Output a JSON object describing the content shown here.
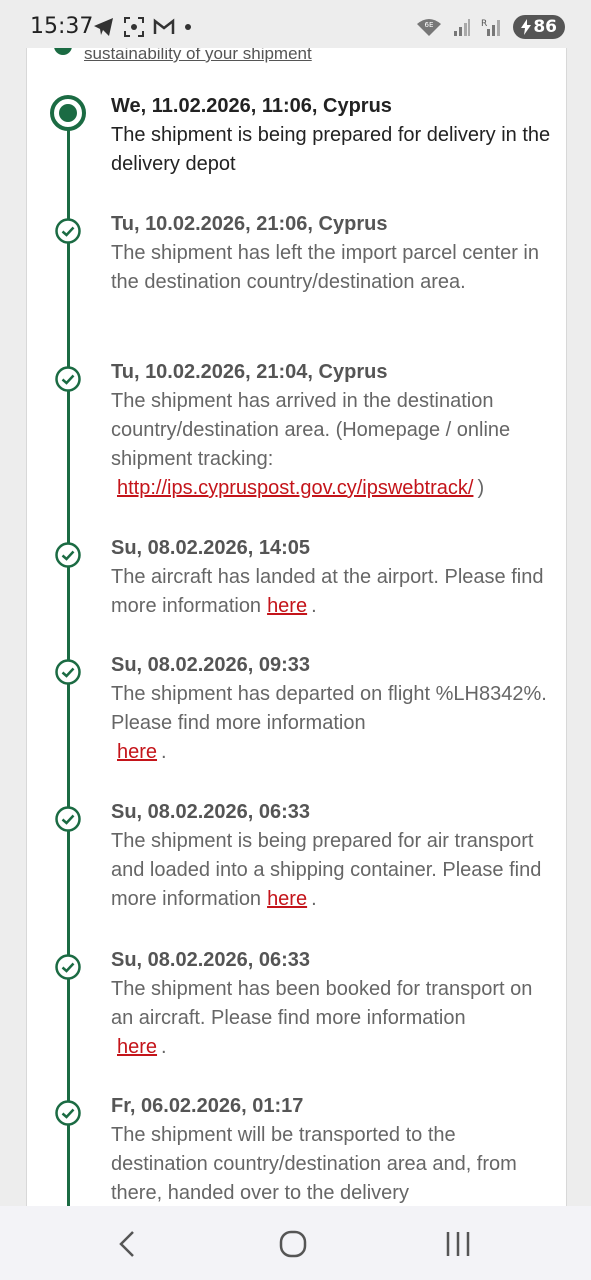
{
  "status_bar": {
    "time": "15:37",
    "battery": "86",
    "left_icons": [
      "telegram-icon",
      "screenshot-icon",
      "gmail-icon",
      "dot-icon"
    ],
    "right_icons": [
      "wifi-6e-icon",
      "signal-icon",
      "signal-r-icon",
      "battery-charging-icon"
    ]
  },
  "header": {
    "link_text": "sustainability of your shipment"
  },
  "events": [
    {
      "date": "We, 11.02.2026, 11:06, Cyprus",
      "desc": "The shipment is being prepared for delivery in the delivery depot",
      "link": "",
      "suffix": "",
      "current": true
    },
    {
      "date": "Tu, 10.02.2026, 21:06, Cyprus",
      "desc": "The shipment has left the import parcel center in the destination country/destination area.",
      "link": "",
      "suffix": ""
    },
    {
      "date": "Tu, 10.02.2026, 21:04, Cyprus",
      "desc": "The shipment has arrived in the destination country/destination area. (Homepage / online shipment tracking:",
      "link": "http://ips.cypruspost.gov.cy/ipswebtrack/",
      "suffix": ")"
    },
    {
      "date": "Su, 08.02.2026, 14:05",
      "desc": "The aircraft has landed at the airport. Please find more information",
      "link": "here",
      "suffix": "."
    },
    {
      "date": "Su, 08.02.2026, 09:33",
      "desc": "The shipment has departed on flight %LH8342%. Please find more information",
      "link": "here",
      "suffix": "."
    },
    {
      "date": "Su, 08.02.2026, 06:33",
      "desc": "The shipment is being prepared for air transport and loaded into a shipping container. Please find more information",
      "link": "here",
      "suffix": "."
    },
    {
      "date": "Su, 08.02.2026, 06:33",
      "desc": "The shipment has been booked for transport on an aircraft. Please find more information",
      "link": "here",
      "suffix": "."
    },
    {
      "date": "Fr, 06.02.2026, 01:17",
      "desc": "The shipment will be transported to the destination country/destination area and, from there, handed over to the delivery",
      "link": "",
      "suffix": ""
    }
  ],
  "colors": {
    "timeline": "#1b6b43",
    "link_red": "#c4141a"
  },
  "nav": {
    "buttons": [
      "back-icon",
      "home-icon",
      "recents-icon"
    ]
  }
}
